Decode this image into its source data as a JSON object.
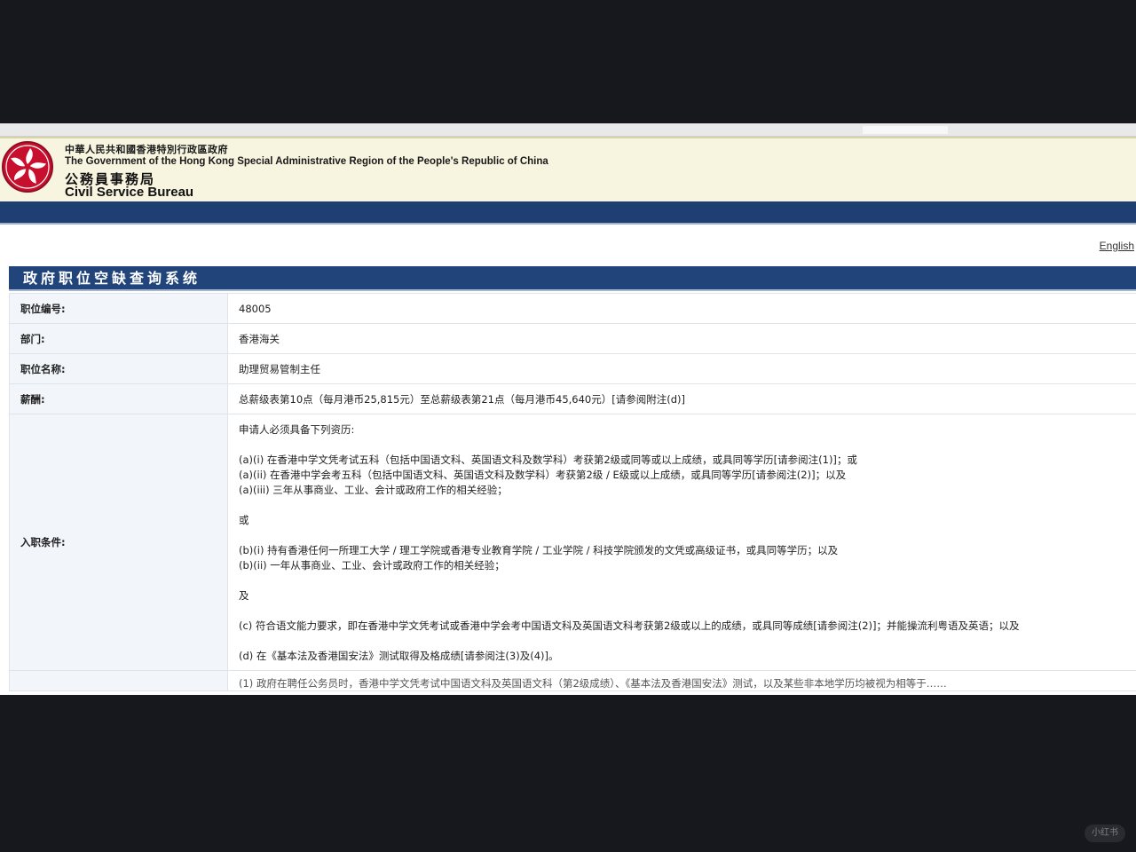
{
  "banner": {
    "gov_name_zh": "中華人民共和國香港特別行政區政府",
    "gov_name_en": "The Government of the Hong Kong Special Administrative Region of the People's Republic of China",
    "bureau_zh": "公務員事務局",
    "bureau_en": "Civil Service Bureau"
  },
  "lang_link": "English",
  "system_title": "政府职位空缺查询系统",
  "job": {
    "rows": [
      {
        "label": "职位编号:",
        "value": "48005"
      },
      {
        "label": "部门:",
        "value": "香港海关"
      },
      {
        "label": "职位名称:",
        "value": "助理贸易管制主任"
      },
      {
        "label": "薪酬:",
        "value": "总薪级表第10点（每月港币25,815元）至总薪级表第21点（每月港币45,640元）[请参阅附注(d)]"
      }
    ],
    "requirements": {
      "label": "入职条件:",
      "intro": "申请人必须具备下列资历:",
      "a1": "(a)(i) 在香港中学文凭考试五科（包括中国语文科、英国语文科及数学科）考获第2级或同等或以上成绩，或具同等学历[请参阅注(1)]；或",
      "a2": "(a)(ii) 在香港中学会考五科（包括中国语文科、英国语文科及数学科）考获第2级 / E级或以上成绩，或具同等学历[请参阅注(2)]；以及",
      "a3": "(a)(iii) 三年从事商业、工业、会计或政府工作的相关经验；",
      "or": "或",
      "b1": "(b)(i) 持有香港任何一所理工大学 / 理工学院或香港专业教育学院 / 工业学院 / 科技学院颁发的文凭或高级证书，或具同等学历；以及",
      "b2": "(b)(ii) 一年从事商业、工业、会计或政府工作的相关经验；",
      "and": "及",
      "c": "(c) 符合语文能力要求，即在香港中学文凭考试或香港中学会考中国语文科及英国语文科考获第2级或以上的成绩，或具同等成绩[请参阅注(2)]；并能操流利粤语及英语；以及",
      "d": "(d) 在《基本法及香港国安法》测试取得及格成绩[请参阅注(3)及(4)]。"
    },
    "cut_row_text": "(1) 政府在聘任公务员时，香港中学文凭考试中国语文科及英国语文科（第2级成绩）、《基本法及香港国安法》测试，以及某些非本地学历均被视为相等于……"
  },
  "watermark": "小红书"
}
